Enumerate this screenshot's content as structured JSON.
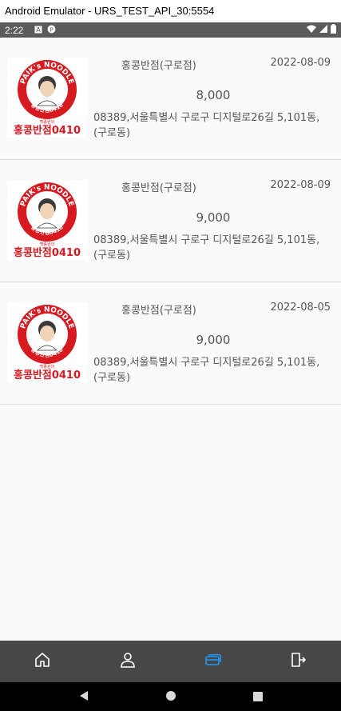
{
  "window": {
    "title": "Android Emulator - URS_TEST_API_30:5554"
  },
  "status_bar": {
    "time": "2:22",
    "icons_left": [
      "a-icon",
      "p-icon"
    ],
    "icons_right": [
      "wifi-icon",
      "signal-icon",
      "battery-icon"
    ]
  },
  "orders": [
    {
      "store": "홍콩반점(구로점)",
      "date": "2022-08-09",
      "price": "8,000",
      "address": "08389,서울특별시 구로구 디지털로26길 5,101동,(구로동)",
      "logo": {
        "top_text": "PAIK's NOODLE",
        "ring_text": "홍콩반점0410",
        "bottom_text": "홍콩반점0410",
        "small_text": "백종원의"
      }
    },
    {
      "store": "홍콩반점(구로점)",
      "date": "2022-08-09",
      "price": "9,000",
      "address": "08389,서울특별시 구로구 디지털로26길 5,101동,(구로동)",
      "logo": {
        "top_text": "PAIK's NOODLE",
        "ring_text": "홍콩반점0410",
        "bottom_text": "홍콩반점0410",
        "small_text": "백종원의"
      }
    },
    {
      "store": "홍콩반점(구로점)",
      "date": "2022-08-05",
      "price": "9,000",
      "address": "08389,서울특별시 구로구 디지털로26길 5,101동,(구로동)",
      "logo": {
        "top_text": "PAIK's NOODLE",
        "ring_text": "홍콩반점0410",
        "bottom_text": "홍콩반점0410",
        "small_text": "백종원의"
      }
    }
  ],
  "bottom_nav": {
    "items": [
      {
        "icon": "home-icon",
        "active": false
      },
      {
        "icon": "person-icon",
        "active": false
      },
      {
        "icon": "card-icon",
        "active": true
      },
      {
        "icon": "logout-icon",
        "active": false
      }
    ],
    "active_color": "#2196f3",
    "inactive_color": "#ffffff"
  },
  "colors": {
    "logo_red": "#d71920",
    "status_bar": "#5b5b5b",
    "nav_bg": "#474747"
  }
}
